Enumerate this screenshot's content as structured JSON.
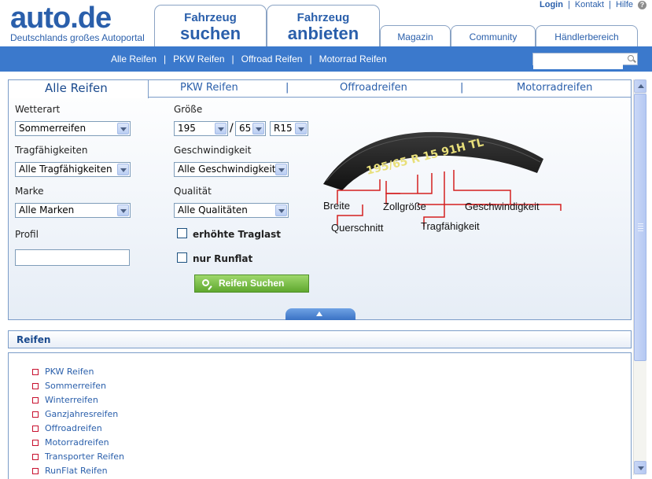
{
  "header": {
    "logo_text": "auto.de",
    "logo_tagline": "Deutschlands großes Autoportal",
    "top_links": {
      "login": "Login",
      "contact": "Kontakt",
      "help": "Hilfe",
      "separator": "|"
    },
    "main_tabs": [
      {
        "line1": "Fahrzeug",
        "line2": "suchen"
      },
      {
        "line1": "Fahrzeug",
        "line2": "anbieten"
      }
    ],
    "secondary_tabs": [
      "Magazin",
      "Community",
      "Händlerbereich"
    ]
  },
  "nav": {
    "links": [
      "Alle Reifen",
      "PKW Reifen",
      "Offroad Reifen",
      "Motorrad Reifen"
    ],
    "separator": "|",
    "search_value": ""
  },
  "tire_search": {
    "tabs": [
      "Alle Reifen",
      "PKW Reifen",
      "Offroadreifen",
      "Motorradreifen"
    ],
    "tab_separator": "|",
    "active_tab": "Alle Reifen",
    "labels": {
      "weather": "Wetterart",
      "size": "Größe",
      "load": "Tragfähigkeiten",
      "speed": "Geschwindigkeit",
      "brand": "Marke",
      "quality": "Qualität",
      "profile": "Profil"
    },
    "selects": {
      "weather": "Sommerreifen",
      "width": "195",
      "height": "65",
      "rim": "R15",
      "load": "Alle Tragfähigkeiten",
      "speed": "Alle Geschwindigkeiten",
      "brand": "Alle Marken",
      "quality": "Alle Qualitäten"
    },
    "size_separator": "/",
    "profile_value": "",
    "checkboxes": [
      {
        "label": "erhöhte Traglast",
        "checked": false
      },
      {
        "label": "nur Runflat",
        "checked": false
      }
    ],
    "search_button": "Reifen Suchen",
    "tire_diagram": {
      "marking": "195/65 R 15 91H TL",
      "labels": [
        "Breite",
        "Querschnitt",
        "Zollgröße",
        "Tragfähigkeit",
        "Geschwindigkeit"
      ],
      "accent_color": "#d42020"
    }
  },
  "reifen": {
    "title": "Reifen",
    "items": [
      "PKW Reifen",
      "Sommerreifen",
      "Winterreifen",
      "Ganzjahresreifen",
      "Offroadreifen",
      "Motorradreifen",
      "Transporter Reifen",
      "RunFlat Reifen"
    ]
  },
  "colors": {
    "brand_blue": "#2a5fab",
    "nav_blue": "#3b79cc",
    "button_green": "#6fb83a",
    "bullet_red": "#c8102e"
  }
}
